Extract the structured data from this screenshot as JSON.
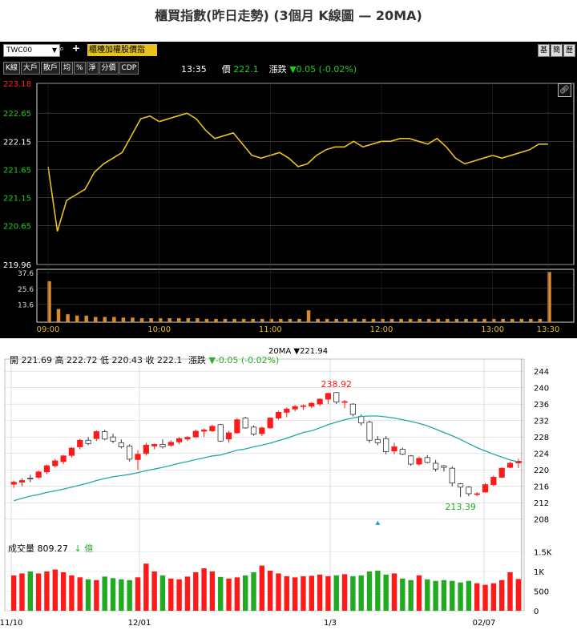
{
  "page": {
    "title": "櫃買指數(昨日走勢) (3個月 K線圖 — 20MA)"
  },
  "intraday": {
    "symbol_input": "TWC00",
    "banner": "櫃檯加權股價指",
    "tabs": [
      "K線",
      "大戶",
      "散戶",
      "均",
      "%",
      "淨",
      "分價",
      "CDP"
    ],
    "right_buttons": [
      "基",
      "簡",
      "歷"
    ],
    "time": "13:35",
    "price_label": "價",
    "price": "222.1",
    "change_label": "漲跌",
    "change": "▼0.05 (-0.02%)",
    "colors": {
      "bg": "#000000",
      "line": "#e8c21e",
      "volume": "#d98a2a",
      "down": "#22cc22",
      "up": "#ff2020"
    },
    "chart_data": {
      "type": "line",
      "x_ticks": [
        "09:00",
        "10:00",
        "11:00",
        "12:00",
        "13:00",
        "13:30"
      ],
      "y_ticks": [
        223.18,
        222.65,
        222.15,
        221.65,
        221.15,
        220.65,
        219.96
      ],
      "ylim": [
        219.96,
        223.18
      ],
      "x": [
        "09:00",
        "09:05",
        "09:10",
        "09:15",
        "09:20",
        "09:25",
        "09:30",
        "09:35",
        "09:40",
        "09:45",
        "09:50",
        "09:55",
        "10:00",
        "10:05",
        "10:10",
        "10:15",
        "10:20",
        "10:25",
        "10:30",
        "10:35",
        "10:40",
        "10:45",
        "10:50",
        "10:55",
        "11:00",
        "11:05",
        "11:10",
        "11:15",
        "11:20",
        "11:25",
        "11:30",
        "11:35",
        "11:40",
        "11:45",
        "11:50",
        "11:55",
        "12:00",
        "12:05",
        "12:10",
        "12:15",
        "12:20",
        "12:25",
        "12:30",
        "12:35",
        "12:40",
        "12:45",
        "12:50",
        "12:55",
        "13:00",
        "13:05",
        "13:10",
        "13:15",
        "13:20",
        "13:25",
        "13:30"
      ],
      "values": [
        221.7,
        220.55,
        221.1,
        221.2,
        221.3,
        221.6,
        221.75,
        221.85,
        221.95,
        222.25,
        222.55,
        222.6,
        222.5,
        222.55,
        222.6,
        222.65,
        222.55,
        222.35,
        222.2,
        222.25,
        222.3,
        222.1,
        221.9,
        221.85,
        221.9,
        221.95,
        221.85,
        221.7,
        221.75,
        221.9,
        222.0,
        222.05,
        222.05,
        222.15,
        222.05,
        222.1,
        222.15,
        222.15,
        222.2,
        222.2,
        222.15,
        222.1,
        222.2,
        222.05,
        221.85,
        221.75,
        221.8,
        221.85,
        221.9,
        221.85,
        221.9,
        221.95,
        222.0,
        222.1,
        222.1
      ],
      "volume_ticks": [
        37.6,
        25.6,
        13.6
      ],
      "volume_ylim": [
        0,
        40
      ],
      "volume": [
        31,
        10,
        6,
        5,
        5,
        4,
        4,
        4,
        3.5,
        3.5,
        3,
        3,
        3,
        3,
        3,
        3,
        3,
        2.5,
        2.5,
        2.5,
        2.5,
        2.5,
        2.5,
        2.5,
        2.5,
        2.5,
        2.5,
        2.5,
        9,
        2.5,
        2.5,
        2.5,
        2.5,
        2.5,
        2.5,
        2.5,
        2.5,
        2.5,
        2.5,
        2.5,
        2.5,
        2.5,
        2.5,
        2.5,
        2.5,
        2.5,
        2.5,
        2.5,
        2.5,
        2.5,
        2.5,
        2.5,
        2.5,
        2.5,
        38
      ]
    }
  },
  "daily": {
    "ohlc_label": "開 221.69  高 222.72  低 220.43  收 222.1",
    "change_label": "漲跌",
    "change": "▼-0.05 (-0.02%)",
    "ma_label": "20MA ▼221.94",
    "vol_label": "成交量 809.27",
    "vol_unit": "↓ 億",
    "high_note": "238.92",
    "low_note": "213.39",
    "colors": {
      "up": "#ff1a1a",
      "down": "#e8e8e8",
      "ma": "#20a8a8",
      "vol_up": "#ff1a1a",
      "vol_down": "#22aa22"
    },
    "chart_data": {
      "type": "candlestick",
      "x_ticks": [
        "11/10",
        "12/01",
        "1/3",
        "02/07"
      ],
      "y_ticks": [
        244,
        240,
        236,
        232,
        228,
        224,
        220,
        216,
        212,
        208
      ],
      "ylim": [
        206,
        245
      ],
      "vol_ticks": [
        "1.5K",
        "1K",
        "500",
        "0"
      ],
      "vol_ylim": [
        0,
        1550
      ],
      "candles": [
        [
          216.5,
          217.4,
          215.6,
          217.0
        ],
        [
          217.0,
          218.0,
          216.0,
          217.4
        ],
        [
          218.0,
          218.8,
          217.0,
          217.8
        ],
        [
          218.2,
          219.8,
          217.8,
          219.5
        ],
        [
          219.5,
          221.3,
          219.0,
          221.0
        ],
        [
          221.0,
          222.7,
          220.6,
          222.2
        ],
        [
          222.0,
          223.6,
          221.4,
          223.4
        ],
        [
          223.5,
          225.5,
          223.0,
          225.3
        ],
        [
          225.6,
          227.6,
          225.0,
          227.2
        ],
        [
          227.2,
          228.0,
          226.0,
          226.4
        ],
        [
          227.6,
          229.6,
          227.0,
          229.3
        ],
        [
          229.3,
          229.8,
          227.2,
          227.5
        ],
        [
          228.0,
          228.8,
          226.5,
          227.0
        ],
        [
          226.6,
          227.4,
          225.2,
          225.6
        ],
        [
          225.8,
          226.2,
          222.0,
          222.6
        ],
        [
          222.5,
          224.8,
          220.0,
          223.8
        ],
        [
          224.0,
          226.6,
          223.5,
          226.0
        ],
        [
          225.8,
          226.4,
          225.0,
          226.2
        ],
        [
          226.2,
          227.4,
          225.2,
          225.6
        ],
        [
          226.0,
          227.2,
          225.6,
          226.7
        ],
        [
          226.8,
          228.0,
          226.2,
          227.6
        ],
        [
          227.5,
          228.2,
          227.0,
          227.9
        ],
        [
          228.0,
          229.8,
          227.8,
          229.4
        ],
        [
          229.4,
          230.0,
          228.0,
          229.7
        ],
        [
          229.5,
          231.0,
          229.2,
          230.6
        ],
        [
          231.0,
          231.2,
          226.8,
          227.0
        ],
        [
          227.5,
          229.5,
          226.6,
          229.0
        ],
        [
          229.0,
          232.6,
          228.8,
          232.2
        ],
        [
          232.6,
          232.9,
          230.0,
          230.2
        ],
        [
          230.4,
          230.8,
          228.3,
          228.7
        ],
        [
          228.8,
          230.5,
          228.2,
          230.2
        ],
        [
          230.2,
          232.8,
          230.0,
          232.6
        ],
        [
          232.6,
          234.4,
          232.2,
          234.0
        ],
        [
          234.0,
          235.2,
          232.8,
          234.8
        ],
        [
          234.8,
          235.8,
          234.2,
          235.4
        ],
        [
          235.4,
          235.9,
          234.6,
          235.6
        ],
        [
          235.5,
          236.5,
          235.0,
          236.2
        ],
        [
          236.0,
          237.4,
          235.5,
          237.2
        ],
        [
          237.2,
          238.8,
          236.0,
          238.6
        ],
        [
          238.8,
          238.92,
          236.0,
          236.5
        ],
        [
          236.5,
          237.0,
          235.0,
          236.6
        ],
        [
          236.0,
          236.2,
          233.0,
          233.5
        ],
        [
          233.0,
          233.5,
          230.8,
          231.4
        ],
        [
          231.6,
          232.0,
          226.6,
          227.2
        ],
        [
          227.4,
          228.2,
          226.0,
          226.6
        ],
        [
          227.6,
          228.2,
          223.8,
          224.4
        ],
        [
          224.6,
          226.6,
          223.8,
          225.6
        ],
        [
          225.0,
          225.4,
          223.6,
          223.8
        ],
        [
          223.4,
          223.6,
          221.0,
          221.4
        ],
        [
          221.4,
          223.2,
          221.0,
          222.8
        ],
        [
          223.0,
          223.6,
          221.6,
          221.8
        ],
        [
          221.6,
          222.4,
          219.6,
          220.2
        ],
        [
          221.0,
          221.2,
          219.6,
          220.6
        ],
        [
          220.4,
          220.8,
          216.0,
          216.8
        ],
        [
          216.6,
          216.8,
          213.39,
          215.8
        ],
        [
          215.8,
          216.0,
          213.6,
          214.2
        ],
        [
          214.0,
          214.6,
          213.6,
          214.2
        ],
        [
          214.6,
          216.8,
          214.4,
          216.4
        ],
        [
          216.4,
          218.6,
          216.0,
          218.2
        ],
        [
          218.2,
          220.6,
          218.0,
          220.4
        ],
        [
          220.6,
          222.0,
          220.4,
          221.6
        ],
        [
          221.69,
          222.72,
          220.43,
          222.1
        ]
      ],
      "ma20": [
        212.5,
        213.1,
        213.6,
        214.0,
        214.5,
        214.9,
        215.3,
        215.8,
        216.3,
        216.8,
        217.4,
        217.9,
        218.3,
        218.6,
        218.9,
        219.3,
        219.8,
        220.2,
        220.6,
        221.1,
        221.6,
        222.0,
        222.5,
        222.9,
        223.4,
        223.6,
        224.2,
        224.8,
        225.1,
        225.6,
        226.0,
        226.5,
        227.1,
        227.7,
        228.4,
        229.1,
        229.5,
        230.2,
        231.0,
        231.6,
        232.2,
        232.6,
        233.0,
        233.1,
        233.1,
        232.9,
        232.6,
        232.2,
        231.8,
        231.3,
        230.7,
        229.9,
        229.1,
        228.3,
        227.4,
        226.4,
        225.4,
        224.6,
        223.8,
        223.1,
        222.4,
        221.94
      ],
      "volume": [
        900,
        950,
        1000,
        950,
        1000,
        1050,
        980,
        900,
        850,
        800,
        780,
        870,
        830,
        800,
        780,
        850,
        1200,
        1000,
        900,
        820,
        800,
        870,
        980,
        1080,
        1000,
        860,
        820,
        850,
        900,
        980,
        1150,
        1020,
        950,
        880,
        850,
        880,
        890,
        920,
        880,
        900,
        930,
        880,
        900,
        1000,
        1020,
        920,
        950,
        820,
        780,
        900,
        800,
        760,
        780,
        760,
        720,
        760,
        700,
        660,
        700,
        780,
        980,
        809.27
      ],
      "low_marker_index": 54,
      "high_marker_index": 39,
      "triangle_marker_index": 44
    }
  }
}
